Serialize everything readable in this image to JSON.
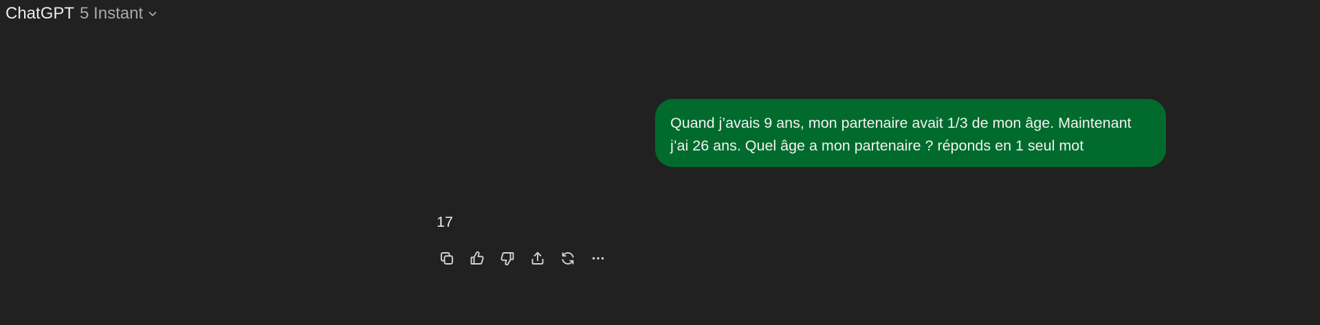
{
  "header": {
    "app_name": "ChatGPT",
    "model_version": "5 Instant",
    "dropdown_icon": "chevron-down-icon"
  },
  "conversation": {
    "user_message": {
      "line1": "Quand j’avais 9 ans, mon partenaire avait 1/3 de mon âge. Maintenant",
      "line2": "j’ai 26 ans. Quel âge a mon partenaire ? réponds en 1 seul mot",
      "bubble_color": "#006b2d"
    },
    "assistant_message": {
      "text": "17"
    },
    "actions": [
      {
        "name": "copy",
        "icon": "copy-icon"
      },
      {
        "name": "good-response",
        "icon": "thumbs-up-icon"
      },
      {
        "name": "bad-response",
        "icon": "thumbs-down-icon"
      },
      {
        "name": "share",
        "icon": "share-icon"
      },
      {
        "name": "regenerate",
        "icon": "refresh-icon"
      },
      {
        "name": "more",
        "icon": "more-icon"
      }
    ]
  },
  "colors": {
    "background": "#212121",
    "text": "#ececec",
    "muted": "#a9a9a9"
  }
}
